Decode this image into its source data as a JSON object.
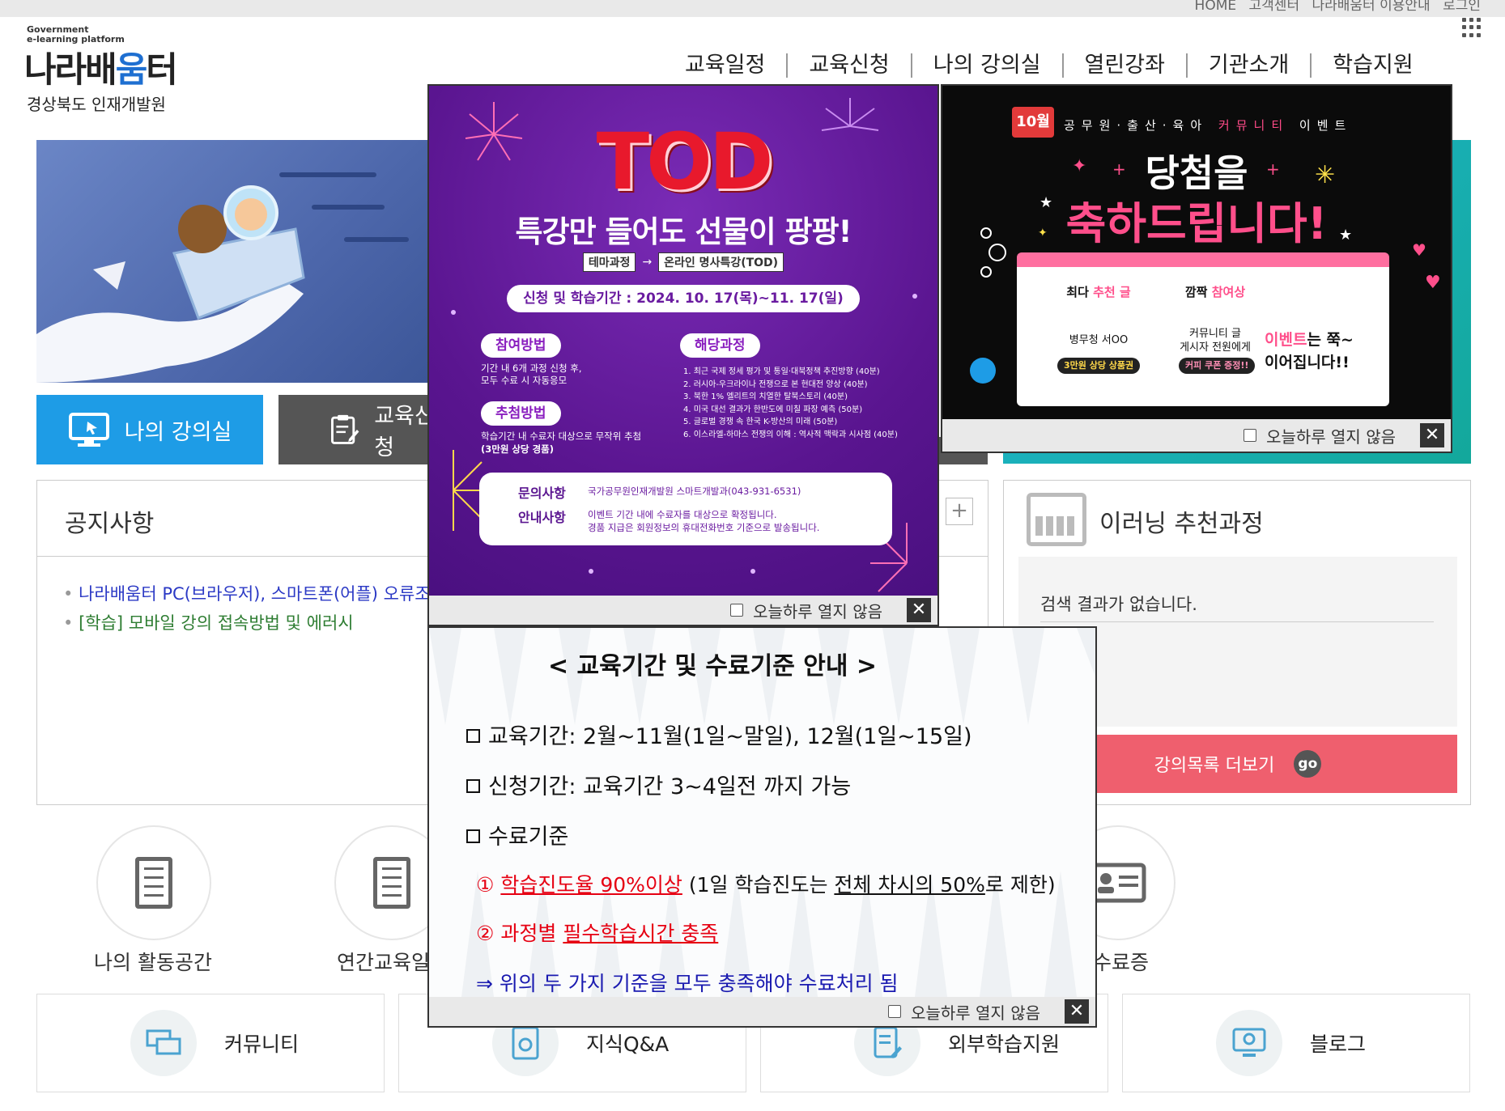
{
  "header": {
    "util_links": [
      "HOME",
      "고객센터",
      "나라배움터 이용안내",
      "로그인"
    ],
    "logo_small_1": "Government",
    "logo_small_2": "e-learning platform",
    "logo_text_a": "나라배",
    "logo_text_b": "움",
    "logo_text_c": "터",
    "org_name": "경상북도 인재개발원"
  },
  "nav": [
    "교육일정",
    "교육신청",
    "나의 강의실",
    "열린강좌",
    "기관소개",
    "학습지원"
  ],
  "quick_buttons": {
    "my_lecture": "나의 강의실",
    "apply": "교육신청"
  },
  "notice": {
    "title": "공지사항",
    "plus": "+",
    "items": [
      "나라배움터 PC(브라우저), 스마트폰(어플) 오류조치",
      "[학습] 모바일 강의 접속방법 및 에러시"
    ]
  },
  "recommend": {
    "title": "이러닝 추천과정",
    "empty": "검색 결과가 없습니다.",
    "more": "강의목록 더보기",
    "go": "go"
  },
  "quick_icons": [
    "나의 활동공간",
    "연간교육일정",
    "수료증"
  ],
  "cards": [
    "커뮤니티",
    "지식Q&A",
    "외부학습지원",
    "블로그"
  ],
  "popup_tod": {
    "logo": "TOD",
    "headline": "특강만 들어도 선물이 팡팡!",
    "tag1": "테마과정",
    "arrow": "→",
    "tag2": "온라인 명사특강(TOD)",
    "period": "신청 및 학습기간 : 2024. 10. 17(목)~11. 17(일)",
    "how_label": "참여방법",
    "how_text": "기간 내 6개 과정 신청 후,\n모두 수료 시 자동응모",
    "draw_label": "추첨방법",
    "draw_text": "학습기간 내 수료자 대상으로 무작위 추첨",
    "draw_prize": "(3만원 상당 경품)",
    "courses_label": "해당과정",
    "courses": "1. 최근 국제 정세 평가 및 통일·대북정책 추진방향 (40분)\n2. 러시아-우크라이나 전쟁으로 본 현대전 양상 (40분)\n3. 북한 1% 엘리트의 치열한 탈북스토리 (40분)\n4. 미국 대선 결과가 한반도에 미칠 파장 예측 (50분)\n5. 글로벌 경쟁 속 한국 K-방산의 미래 (50분)\n6. 이스라엘-하마스 전쟁의 이해 : 역사적 맥락과 시사점 (40분)",
    "inquiry_label": "문의사항",
    "inquiry_text": "국가공무원인재개발원 스마트개발과(043-931-6531)",
    "guide_label": "안내사항",
    "guide_text": "이벤트 기간 내에 수료자를 대상으로 확정됩니다.\n경품 지급은 회원정보의 휴대전화번호 기준으로 발송됩니다.",
    "dont_show": "오늘하루 열지 않음",
    "close": "✕"
  },
  "popup_event": {
    "month": "10월",
    "header_a": "공무원·출산·육아",
    "header_b": "커뮤니티",
    "header_c": "이벤트",
    "title1": "당첨을",
    "title2": "축하드립니다!",
    "col1_a": "최다",
    "col1_b": "추천 글",
    "col2_a": "깜짝",
    "col2_b": "참여상",
    "col1_winner": "병무청 서OO",
    "col1_prize": "3만원 상당 상품권",
    "col2_winner": "커뮤니티 글\n게시자 전원에게",
    "col2_prize": "커피 쿠폰 증정!!",
    "right_a": "이벤트",
    "right_b": "는 쭉~",
    "right_c": "이어집니다!!",
    "dont_show": "오늘하루 열지 않음",
    "close": "✕"
  },
  "popup_notice": {
    "title": "< 교육기간 및 수료기준 안내 >",
    "line1": "교육기간:  2월~11월(1일~말일), 12월(1일~15일)",
    "line2": "신청기간: 교육기간 3~4일전 까지 가능",
    "line3": "수료기준",
    "c1_num": "①",
    "c1_u": "학습진도율 90%이상",
    "c1_rest_a": " (1일 학습진도는 ",
    "c1_u2": "전체 차시의 50%",
    "c1_rest_b": "로 제한)",
    "c2_num": "② 과정별 ",
    "c2_u": "필수학습시간 충족",
    "line4": "⇒ 위의 두 가지 기준을 모두 충족해야 수료처리 됨",
    "dont_show": "오늘하루 열지 않음",
    "close": "✕"
  },
  "colors": {
    "primary_blue": "#1e9ce6",
    "recommend_pink": "#ef5f6e",
    "tod_purple": "#5a1590",
    "event_pink": "#ff4f8b"
  }
}
